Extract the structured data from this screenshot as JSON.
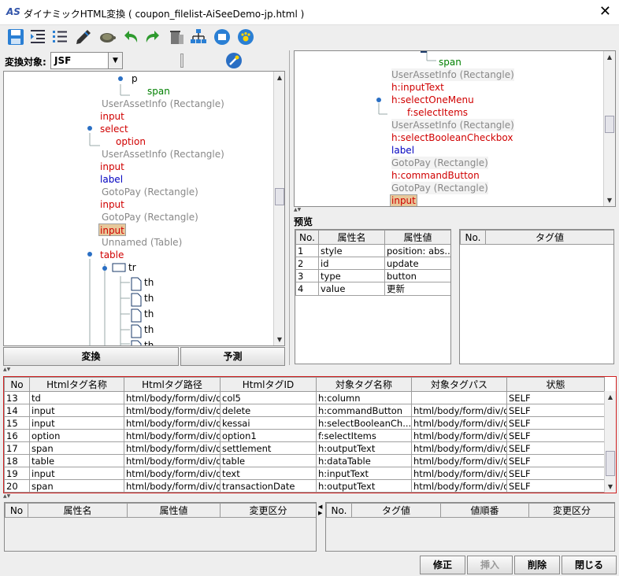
{
  "window": {
    "title": "ダイナミックHTML変換 ( coupon_filelist-AiSeeDemo-jp.html )",
    "app_icon": "AS",
    "close": "✕"
  },
  "toolbar": {
    "icons": [
      "save-icon",
      "indent-icon",
      "list-icon",
      "edit-icon",
      "turtle-icon",
      "undo-icon",
      "redo-icon",
      "delete-icon",
      "tree-icon",
      "info-icon",
      "paw-icon"
    ]
  },
  "left": {
    "target_label": "変換対象:",
    "target_value": "JSF",
    "tree": [
      "p",
      "span",
      "UserAssetInfo (Rectangle)",
      "input",
      "select",
      "option",
      "UserAssetInfo (Rectangle)",
      "input",
      "label",
      "GotoPay (Rectangle)",
      "input",
      "GotoPay (Rectangle)",
      "input",
      "Unnamed (Table)",
      "table",
      "tr",
      "th",
      "th",
      "th",
      "th",
      "th"
    ],
    "convert_button": "変換",
    "predict_button": "予測"
  },
  "right": {
    "tree": [
      "span",
      "UserAssetInfo (Rectangle)",
      "h:inputText",
      "h:selectOneMenu",
      "f:selectItems",
      "UserAssetInfo (Rectangle)",
      "h:selectBooleanCheckbox",
      "label",
      "GotoPay (Rectangle)",
      "h:commandButton",
      "GotoPay (Rectangle)",
      "input"
    ],
    "preview_label": "预览",
    "attr_headers": [
      "No.",
      "属性名",
      "属性値"
    ],
    "attrs": [
      [
        "1",
        "style",
        "position: abs..."
      ],
      [
        "2",
        "id",
        "update"
      ],
      [
        "3",
        "type",
        "button"
      ],
      [
        "4",
        "value",
        "更新"
      ]
    ],
    "tag_headers": [
      "No.",
      "タグ値"
    ]
  },
  "mapping": {
    "headers": [
      "No",
      "Htmlタグ名称",
      "Htmlタグ路径",
      "HtmlタグID",
      "対象タグ名称",
      "対象タグパス",
      "状態"
    ],
    "rows": [
      [
        "13",
        "td",
        "html/body/form/div/d...",
        "col5",
        "h:column",
        "",
        "SELF"
      ],
      [
        "14",
        "input",
        "html/body/form/div/d...",
        "delete",
        "h:commandButton",
        "html/body/form/div/d...",
        "SELF"
      ],
      [
        "15",
        "input",
        "html/body/form/div/d...",
        "kessai",
        "h:selectBooleanCh...",
        "html/body/form/div/d...",
        "SELF"
      ],
      [
        "16",
        "option",
        "html/body/form/div/d...",
        "option1",
        "f:selectItems",
        "html/body/form/div/d...",
        "SELF"
      ],
      [
        "17",
        "span",
        "html/body/form/div/d...",
        "settlement",
        "h:outputText",
        "html/body/form/div/d...",
        "SELF"
      ],
      [
        "18",
        "table",
        "html/body/form/div/d...",
        "table",
        "h:dataTable",
        "html/body/form/div/d...",
        "SELF"
      ],
      [
        "19",
        "input",
        "html/body/form/div/d...",
        "text",
        "h:inputText",
        "html/body/form/div/d...",
        "SELF"
      ],
      [
        "20",
        "span",
        "html/body/form/div/d...",
        "transactionDate",
        "h:outputText",
        "html/body/form/div/d...",
        "SELF"
      ]
    ]
  },
  "bottom": {
    "left_headers": [
      "No",
      "属性名",
      "属性値",
      "変更区分"
    ],
    "right_headers": [
      "No.",
      "タグ値",
      "値順番",
      "変更区分"
    ]
  },
  "buttons": {
    "modify": "修正",
    "insert": "挿入",
    "delete": "削除",
    "close": "閉じる"
  }
}
